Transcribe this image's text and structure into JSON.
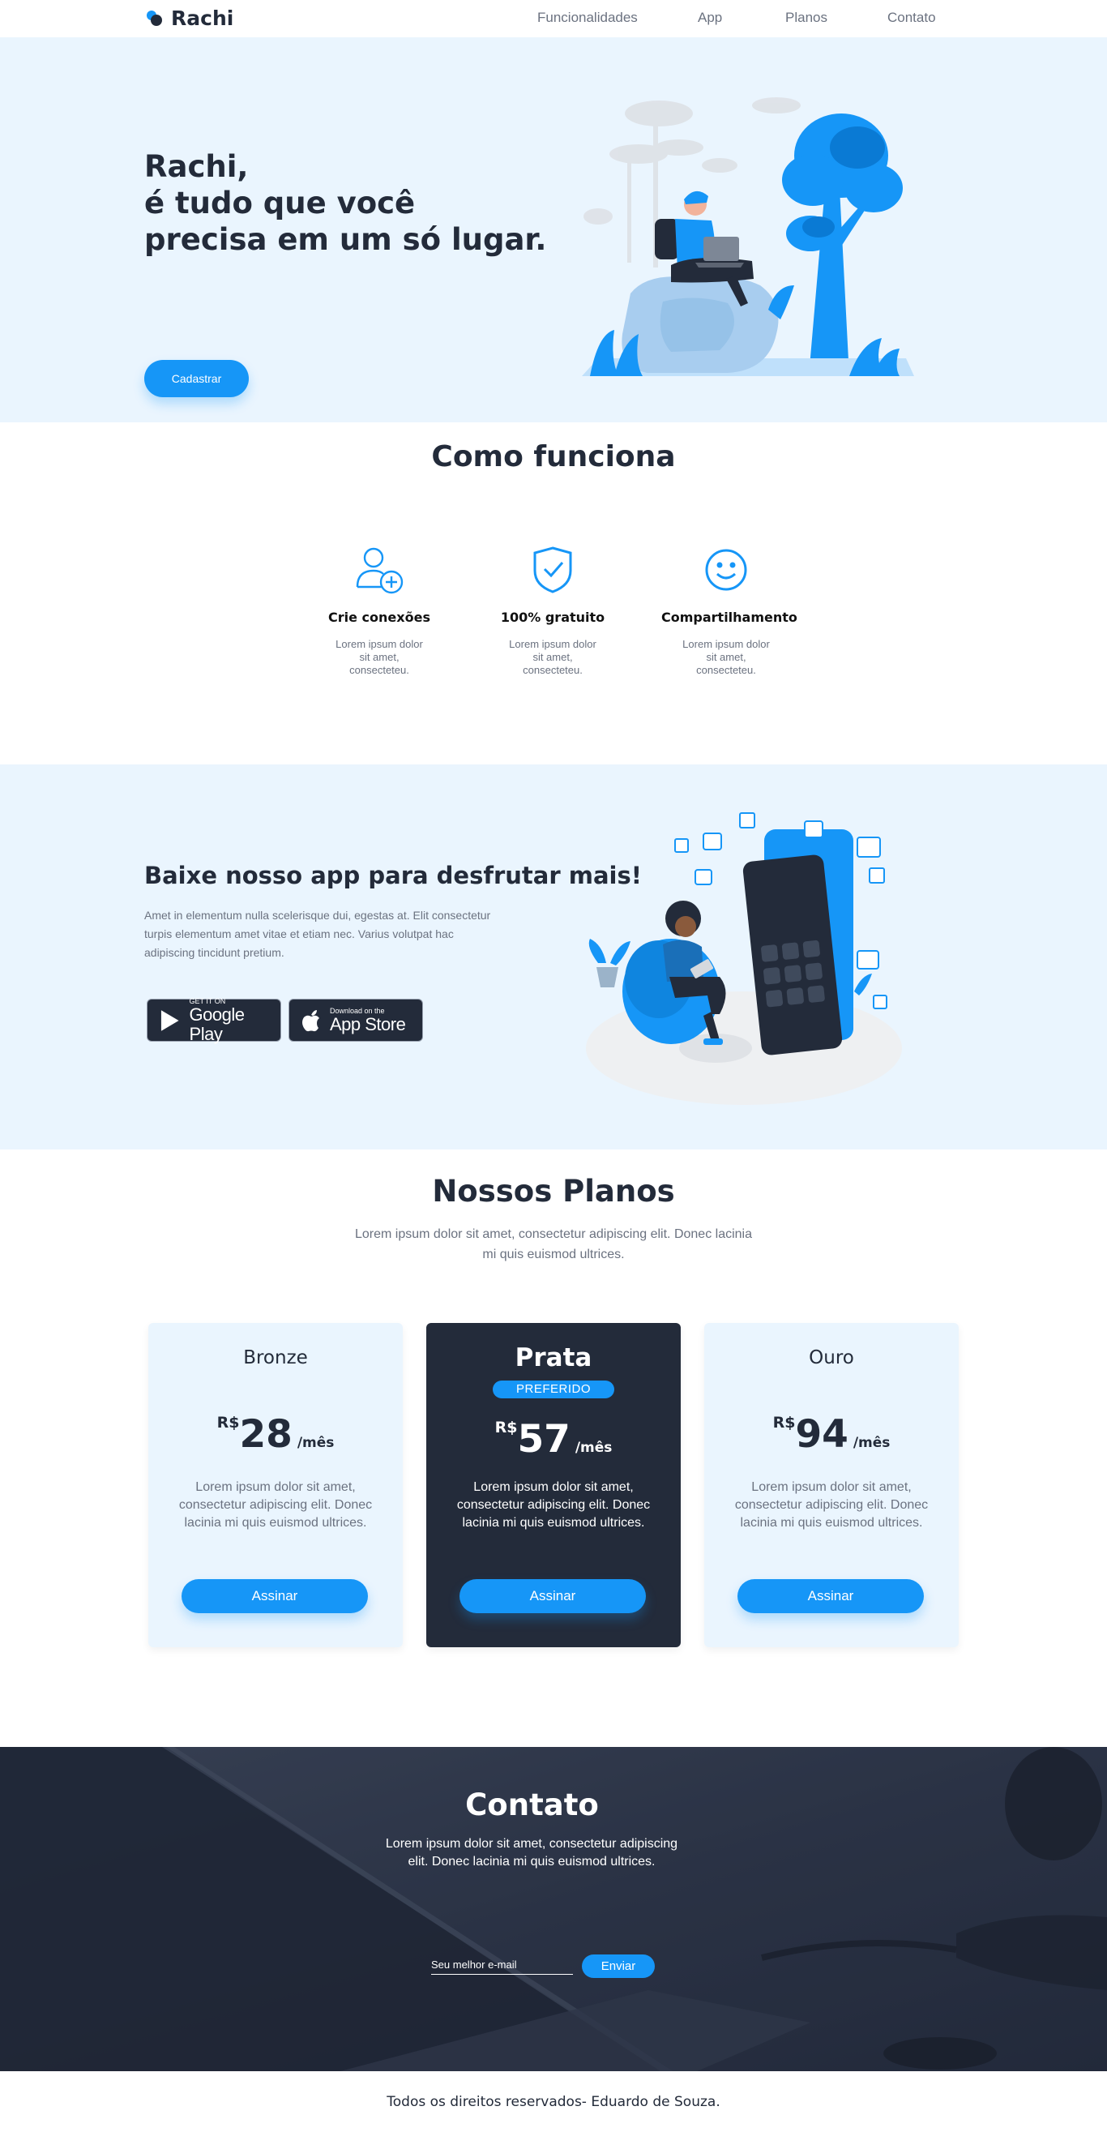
{
  "brand": {
    "name": "Rachi"
  },
  "nav": {
    "items": [
      "Funcionalidades",
      "App",
      "Planos",
      "Contato"
    ]
  },
  "hero": {
    "title_lines": [
      "Rachi,",
      "é tudo que você",
      "precisa em um só lugar."
    ],
    "cta": "Cadastrar"
  },
  "how": {
    "title": "Como funciona",
    "features": [
      {
        "icon": "add-user-icon",
        "name": "Crie conexões",
        "text": "Lorem ipsum dolor sit amet, consecteteu."
      },
      {
        "icon": "shield-check-icon",
        "name": "100% gratuito",
        "text": "Lorem ipsum dolor sit amet, consecteteu."
      },
      {
        "icon": "smile-icon",
        "name": "Compartilhamento",
        "text": "Lorem ipsum dolor sit amet, consecteteu."
      }
    ]
  },
  "app": {
    "title": "Baixe nosso app para desfrutar mais!",
    "text": "Amet in elementum nulla scelerisque dui, egestas at. Elit consectetur turpis elementum amet vitae et etiam nec. Varius volutpat hac adipiscing tincidunt pretium.",
    "google_play": {
      "small": "GET IT ON",
      "big": "Google Play"
    },
    "app_store": {
      "small": "Download on the",
      "big": "App Store"
    }
  },
  "plans": {
    "title": "Nossos Planos",
    "subtitle": "Lorem ipsum dolor sit amet, consectetur adipiscing elit. Donec lacinia mi quis euismod ultrices.",
    "items": [
      {
        "name": "Bronze",
        "currency": "R$",
        "price": "28",
        "period": "/mês",
        "desc": "Lorem ipsum dolor sit amet, consectetur adipiscing elit. Donec lacinia mi quis euismod ultrices.",
        "button": "Assinar"
      },
      {
        "name": "Prata",
        "badge": "PREFERIDO",
        "currency": "R$",
        "price": "57",
        "period": "/mês",
        "desc": "Lorem ipsum dolor sit amet, consectetur adipiscing elit. Donec lacinia mi quis euismod ultrices.",
        "button": "Assinar"
      },
      {
        "name": "Ouro",
        "currency": "R$",
        "price": "94",
        "period": "/mês",
        "desc": "Lorem ipsum dolor sit amet, consectetur adipiscing elit. Donec lacinia mi quis euismod ultrices.",
        "button": "Assinar"
      }
    ]
  },
  "contact": {
    "title": "Contato",
    "text": "Lorem ipsum dolor sit amet, consectetur adipiscing elit. Donec lacinia mi quis euismod ultrices.",
    "email_placeholder": "Seu melhor e-mail",
    "send": "Enviar"
  },
  "footer": {
    "text": "Todos os direitos reservados- Eduardo de Souza."
  },
  "colors": {
    "accent": "#1696f7",
    "dark": "#232b3a",
    "light_bg": "#eaf5fe",
    "muted_text": "#6b7280"
  }
}
